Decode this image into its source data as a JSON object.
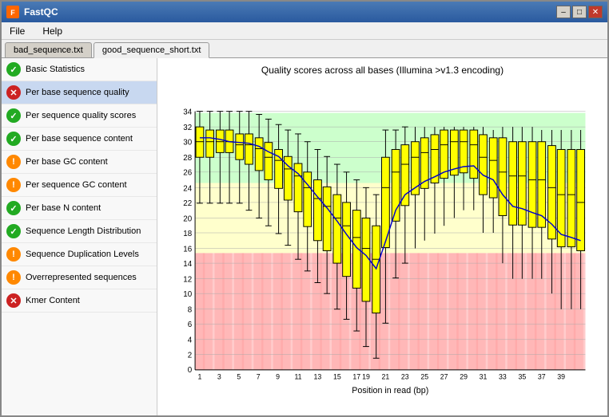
{
  "app": {
    "title": "FastQC",
    "icon": "F"
  },
  "titleButtons": {
    "minimize": "–",
    "maximize": "□",
    "close": "✕"
  },
  "menu": {
    "items": [
      "File",
      "Help"
    ]
  },
  "tabs": [
    {
      "label": "bad_sequence.txt",
      "active": false
    },
    {
      "label": "good_sequence_short.txt",
      "active": true
    }
  ],
  "sidebar": {
    "items": [
      {
        "label": "Basic Statistics",
        "status": "ok"
      },
      {
        "label": "Per base sequence quality",
        "status": "fail"
      },
      {
        "label": "Per sequence quality scores",
        "status": "ok"
      },
      {
        "label": "Per base sequence content",
        "status": "ok"
      },
      {
        "label": "Per base GC content",
        "status": "warn"
      },
      {
        "label": "Per sequence GC content",
        "status": "warn"
      },
      {
        "label": "Per base N content",
        "status": "ok"
      },
      {
        "label": "Sequence Length Distribution",
        "status": "ok"
      },
      {
        "label": "Sequence Duplication Levels",
        "status": "warn"
      },
      {
        "label": "Overrepresented sequences",
        "status": "warn"
      },
      {
        "label": "Kmer Content",
        "status": "fail"
      }
    ]
  },
  "chart": {
    "title": "Quality scores across all bases (Illumina >v1.3 encoding)",
    "xLabel": "Position in read (bp)",
    "yLabel": "",
    "xTicks": [
      "1",
      "3",
      "5",
      "7",
      "9",
      "11",
      "13",
      "15",
      "17",
      "19",
      "21",
      "23",
      "25",
      "27",
      "29",
      "31",
      "33",
      "35",
      "37",
      "39"
    ],
    "yTicks": [
      "2",
      "4",
      "6",
      "8",
      "10",
      "12",
      "14",
      "16",
      "18",
      "20",
      "22",
      "24",
      "26",
      "28",
      "30",
      "32",
      "34"
    ]
  }
}
